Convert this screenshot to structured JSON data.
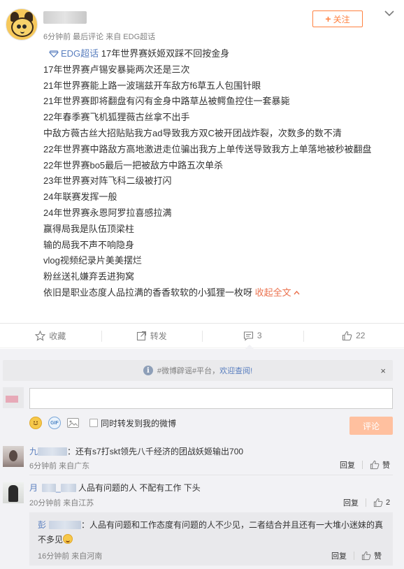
{
  "post": {
    "meta": "6分钟前 最后评论 来自 EDG超话",
    "follow_label": "关注",
    "topic_name": "EDG超话",
    "lines": [
      "17年世界赛妖姬双踩不回按金身",
      "17年世界赛卢锡安暴毙两次还是三次",
      "21年世界赛能上路一波瑞兹开车敌方f6草五人包围针眼",
      "21年世界赛即将翻盘有闪有金身中路草丛被鳄鱼控住一套暴毙",
      "22年春季赛飞机狐狸薇古丝拿不出手",
      "中敌方薇古丝大招贴贴我方ad导致我方双C被开团战炸裂，次数多的数不清",
      "22年世界赛中路敌方高地激进走位骗出我方上单传送导致我方上单落地被秒被翻盘",
      "22年世界赛bo5最后一把被敌方中路五次单杀",
      "23年世界赛对阵飞科二级被打闪",
      "24年联赛发挥一般",
      "24年世界赛永恩阿罗拉喜感拉满",
      "赢得局我是队伍顶梁柱",
      "输的局我不声不响隐身",
      "vlog视频纪录片美美摆烂",
      "粉丝送礼嫌弃丢进狗窝",
      "依旧是职业态度人品拉满的香香软软的小狐狸一枚呀"
    ],
    "expand_label": "收起全文"
  },
  "actions": {
    "favorite": "收藏",
    "repost": "转发",
    "comment_count": "3",
    "like_count": "22"
  },
  "notice": {
    "prefix": "#微博辟谣#平台，",
    "link": "欢迎查阅!",
    "close": "×"
  },
  "composer": {
    "input_value": "",
    "repost_label": "同时转发到我的微博",
    "submit_label": "评论"
  },
  "comments": [
    {
      "name_prefix": "九",
      "text": "：还有s7打skt领先八千经济的团战妖姬输出700",
      "meta": "6分钟前 来自广东",
      "reply_label": "回复",
      "like_label": "赞"
    },
    {
      "name_prefix": "月",
      "name_mid": "_",
      "text": "人品有问题的人 不配有工作 下头",
      "meta": "20分钟前 来自江苏",
      "reply_label": "回复",
      "like_count": "2"
    }
  ],
  "reply": {
    "name_prefix": "彭",
    "text": "人品有问题和工作态度有问题的人不少见，二者结合并且还有一大堆小迷妹的真不多见",
    "meta": "16分钟前 来自河南",
    "reply_label": "回复",
    "like_label": "赞"
  },
  "icons": {
    "menu": "chevron-down-icon",
    "favorite": "star-icon",
    "repost": "share-icon",
    "comment": "comment-icon",
    "like": "thumbs-up-icon",
    "topic": "diamond-icon",
    "emoji": "smiley-icon",
    "gif": "gif-icon",
    "image": "image-icon"
  },
  "colors": {
    "accent": "#ff8140",
    "link": "#5a7fbf",
    "expand": "#eb7350"
  }
}
